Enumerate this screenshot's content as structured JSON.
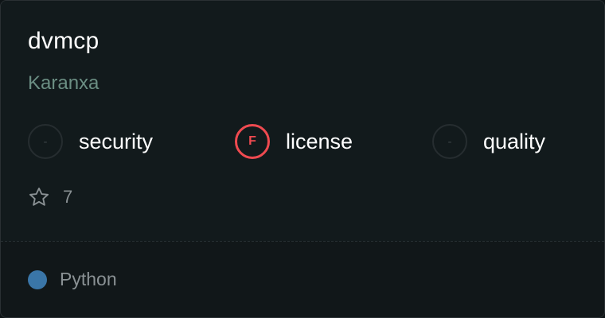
{
  "repo": {
    "name": "dvmcp",
    "owner": "Karanxa"
  },
  "metrics": [
    {
      "label": "security",
      "grade": "-",
      "status": "none"
    },
    {
      "label": "license",
      "grade": "F",
      "status": "fail"
    },
    {
      "label": "quality",
      "grade": "-",
      "status": "none"
    }
  ],
  "stars": {
    "icon": "star-icon",
    "count": "7"
  },
  "language": {
    "name": "Python",
    "color": "#3a76a8"
  },
  "colors": {
    "background": "#111719",
    "owner": "#6b8e83",
    "fail": "#ef4a50"
  }
}
